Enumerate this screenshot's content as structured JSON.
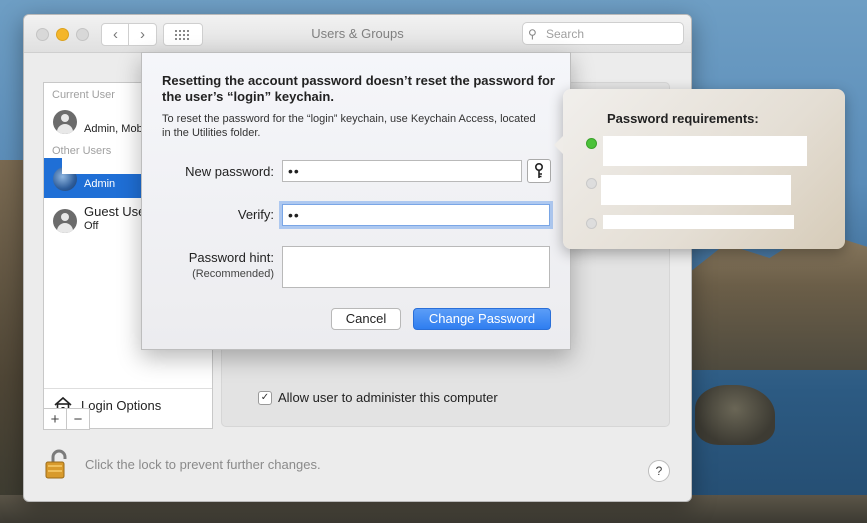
{
  "window": {
    "title": "Users & Groups",
    "search_placeholder": "Search"
  },
  "sidebar": {
    "current_user_header": "Current User",
    "other_users_header": "Other Users",
    "users": [
      {
        "name": "",
        "role": "Admin, Mob",
        "selected": false
      },
      {
        "name": "",
        "role": "Admin",
        "selected": true
      },
      {
        "name": "Guest User",
        "role": "Off",
        "selected": false
      }
    ],
    "login_options_label": "Login Options",
    "add_label": "+",
    "remove_label": "−"
  },
  "main": {
    "allow_admin_label": "Allow user to administer this computer",
    "allow_admin_checked": true
  },
  "footer": {
    "lock_text": "Click the lock to prevent further changes.",
    "help_label": "?"
  },
  "sheet": {
    "title": "Resetting the account password doesn’t reset the password for the user’s “login” keychain.",
    "info": "To reset the password for the “login” keychain, use Keychain Access, located in the Utilities folder.",
    "new_password_label": "New password:",
    "new_password_value": "••",
    "verify_label": "Verify:",
    "verify_value": "••",
    "hint_label": "Password hint:",
    "hint_sublabel": "(Recommended)",
    "hint_value": "",
    "cancel_label": "Cancel",
    "change_label": "Change Password"
  },
  "requirements": {
    "title": "Password requirements:",
    "items": [
      {
        "met": true
      },
      {
        "met": false
      },
      {
        "met": false
      }
    ]
  },
  "colors": {
    "accent": "#2f7ef0",
    "selection": "#1f6fd6",
    "met": "#4cc23a"
  }
}
